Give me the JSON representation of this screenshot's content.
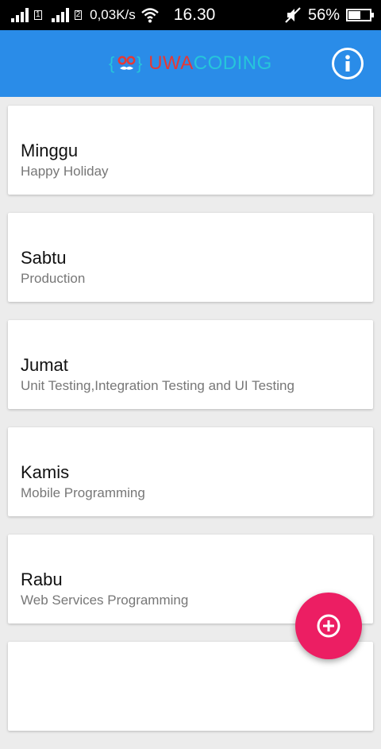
{
  "status_bar": {
    "network_speed": "0,03K/s",
    "time": "16.30",
    "battery_percent": "56%",
    "battery_level": 0.56,
    "icons": [
      "signal-icon",
      "signal-icon",
      "wifi-icon",
      "mute-icon",
      "battery-icon"
    ]
  },
  "app_bar": {
    "logo_part1": "UWA",
    "logo_part2": "CODING",
    "logo_color1": "#e53935",
    "logo_color2": "#26c6da",
    "background": "#2a8ce8",
    "info_icon": "info-icon"
  },
  "schedule": [
    {
      "day": "Minggu",
      "subject": "Happy Holiday"
    },
    {
      "day": "Sabtu",
      "subject": "Production"
    },
    {
      "day": "Jumat",
      "subject": "Unit Testing,Integration Testing and UI Testing"
    },
    {
      "day": "Kamis",
      "subject": "Mobile Programming"
    },
    {
      "day": "Rabu",
      "subject": "Web Services Programming"
    },
    {
      "day": "",
      "subject": ""
    }
  ],
  "fab": {
    "icon": "add-circle-icon",
    "color": "#ec1e63"
  }
}
